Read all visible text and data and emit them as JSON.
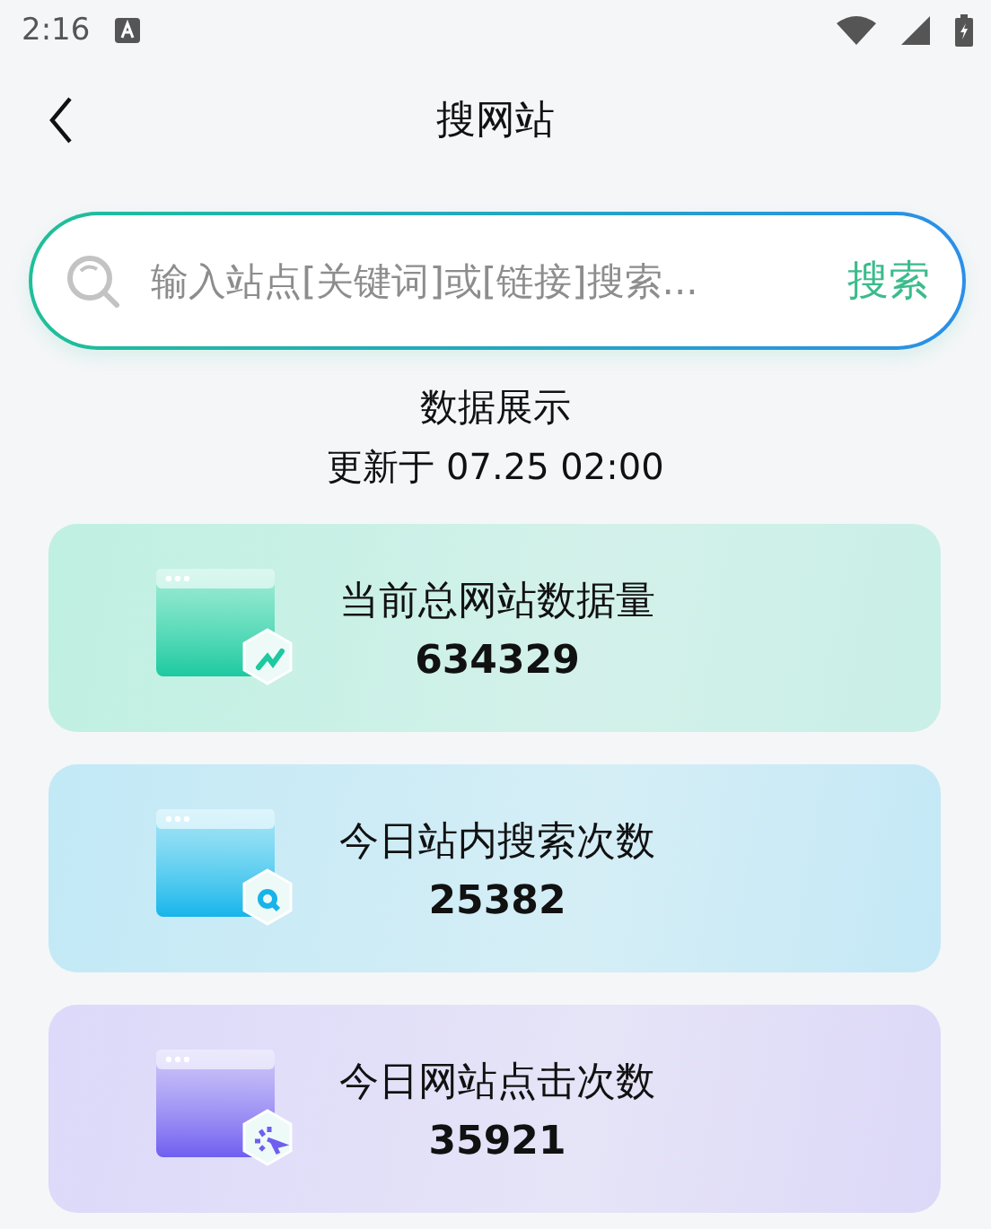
{
  "status_bar": {
    "time": "2:16"
  },
  "header": {
    "title": "搜网站"
  },
  "search": {
    "placeholder": "输入站点[关键词]或[链接]搜索...",
    "button": "搜索"
  },
  "summary": {
    "title": "数据展示",
    "updated": "更新于 07.25 02:00"
  },
  "stats": [
    {
      "kind": "trend",
      "label": "当前总网站数据量",
      "value": "634329"
    },
    {
      "kind": "search",
      "label": "今日站内搜索次数",
      "value": "25382"
    },
    {
      "kind": "click",
      "label": "今日网站点击次数",
      "value": "35921"
    }
  ]
}
